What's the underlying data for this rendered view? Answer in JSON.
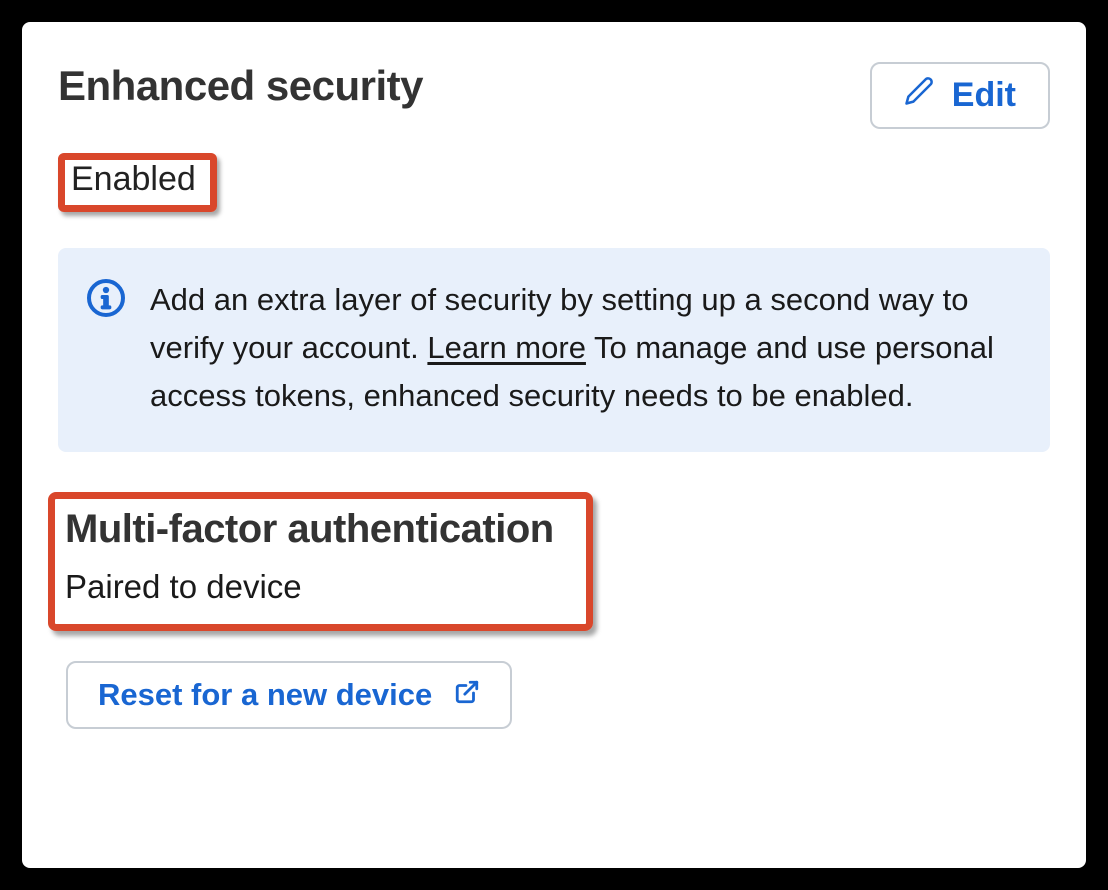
{
  "header": {
    "title": "Enhanced security",
    "edit_label": "Edit"
  },
  "status": "Enabled",
  "info": {
    "text_before_link": "Add an extra layer of security by setting up a second way to verify your account. ",
    "link_text": "Learn more",
    "text_after_link": " To manage and use personal access tokens, enhanced security needs to be enabled."
  },
  "mfa": {
    "title": "Multi-factor authentication",
    "status": "Paired to device",
    "reset_label": "Reset for a new device"
  }
}
